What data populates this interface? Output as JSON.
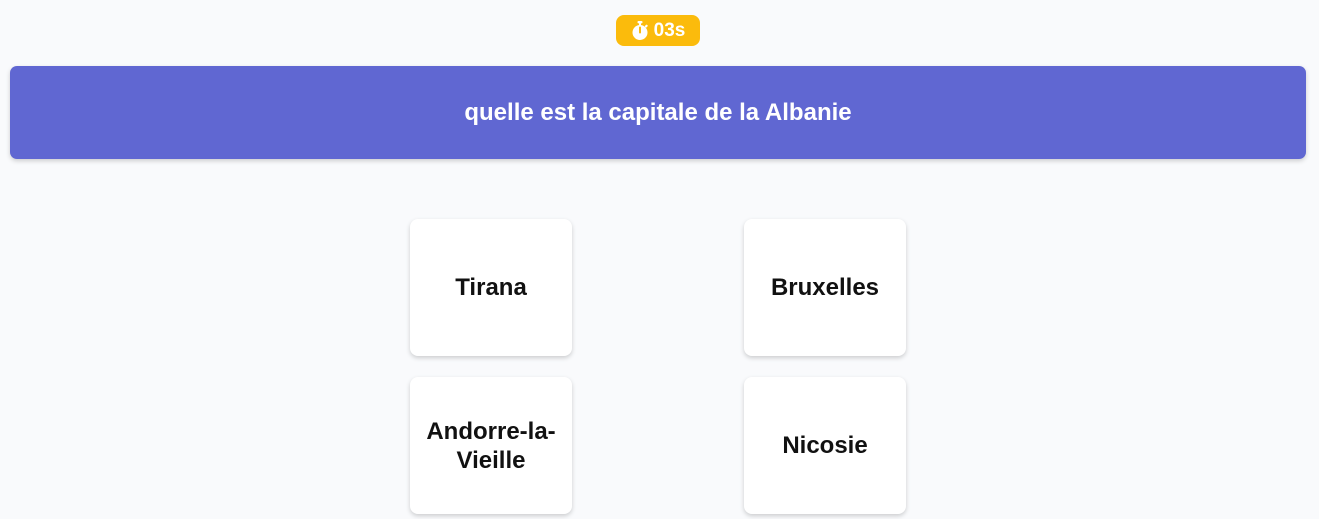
{
  "timer": {
    "label": "03s",
    "icon": "stopwatch-icon",
    "color": "#fbbb0c"
  },
  "question": {
    "text": "quelle est la capitale de la Albanie",
    "color": "#6067d2"
  },
  "answers": [
    {
      "label": "Tirana"
    },
    {
      "label": "Bruxelles"
    },
    {
      "label": "Andorre-la-Vieille"
    },
    {
      "label": "Nicosie"
    }
  ]
}
